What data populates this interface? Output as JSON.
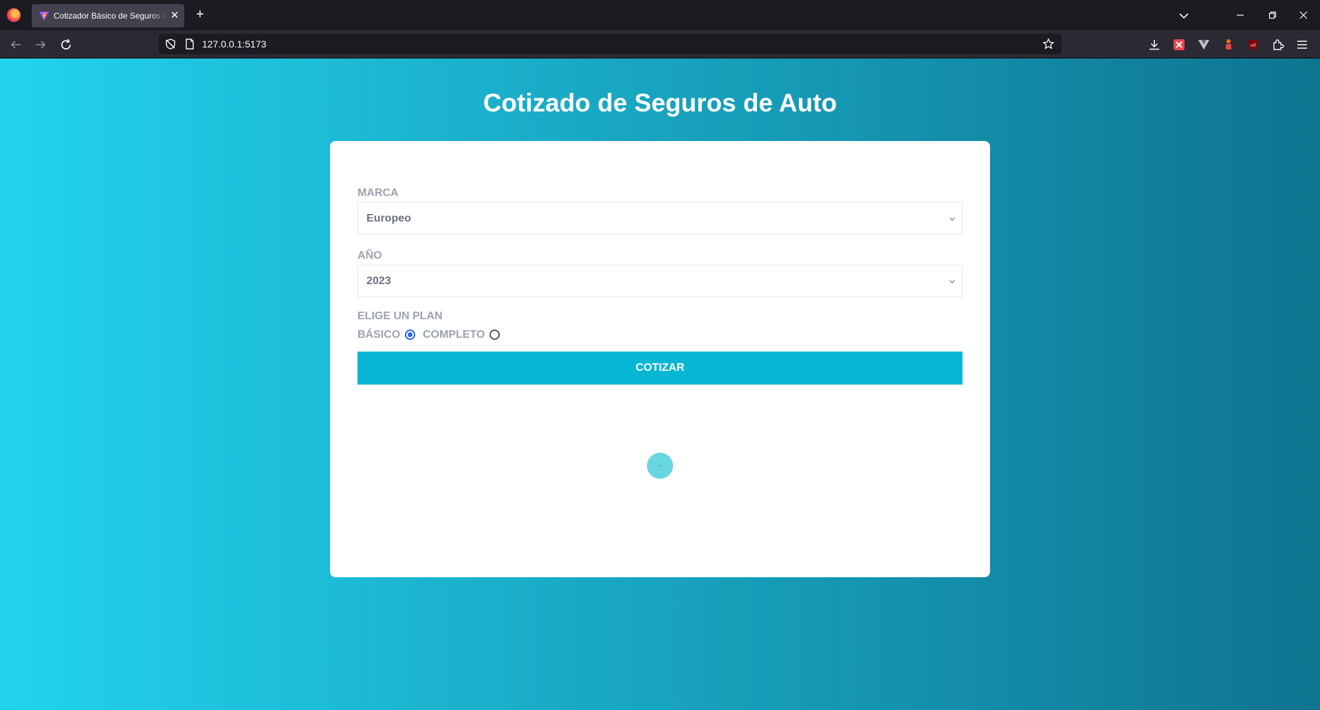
{
  "browser": {
    "tab_title": "Cotizador Básico de Seguros de Auto",
    "url": "127.0.0.1:5173"
  },
  "page": {
    "title": "Cotizado de Seguros de Auto",
    "marca": {
      "label": "MARCA",
      "value": "Europeo"
    },
    "anio": {
      "label": "AÑO",
      "value": "2023"
    },
    "plan": {
      "label": "ELIGE UN PLAN",
      "options": [
        {
          "label": "BÁSICO",
          "checked": true
        },
        {
          "label": "COMPLETO",
          "checked": false
        }
      ]
    },
    "submit_label": "COTIZAR"
  },
  "colors": {
    "gradient_start": "#22d3ee",
    "gradient_end": "#0e7490",
    "button": "#06b6d4",
    "radio_checked": "#2563eb"
  }
}
